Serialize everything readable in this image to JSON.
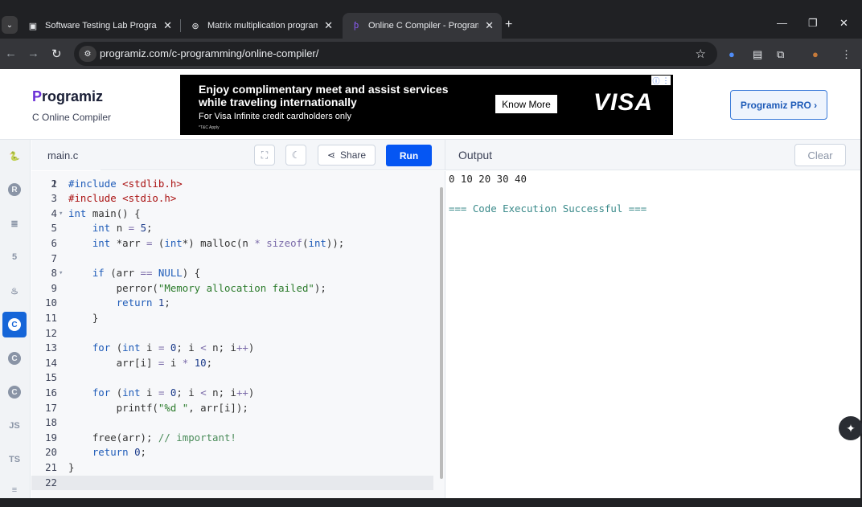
{
  "browser": {
    "tabs": [
      {
        "title": "Software Testing Lab Programs",
        "icon": "page-icon"
      },
      {
        "title": "Matrix multiplication program",
        "icon": "chatgpt-icon"
      },
      {
        "title": "Online C Compiler - Programiz",
        "icon": "programiz-icon",
        "active": true
      }
    ],
    "url": "programiz.com/c-programming/online-compiler/",
    "new_tab_glyph": "+",
    "close_glyph": "✕"
  },
  "site": {
    "logo_first": "P",
    "logo_rest": "rogramiz",
    "logo_sub": "C Online Compiler",
    "pro_button": "Programiz PRO ›"
  },
  "ad": {
    "line1": "Enjoy complimentary meet and assist services",
    "line2": "while traveling internationally",
    "line3": "For Visa Infinite credit cardholders only",
    "line4": "*T&C Apply",
    "cta": "Know More",
    "brand": "VISA"
  },
  "sidebar": {
    "items": [
      {
        "name": "python",
        "label": "🐍"
      },
      {
        "name": "r",
        "label": "R"
      },
      {
        "name": "sql",
        "label": "≣"
      },
      {
        "name": "html",
        "label": "5"
      },
      {
        "name": "java",
        "label": "♨"
      },
      {
        "name": "c",
        "label": "C",
        "active": true
      },
      {
        "name": "cpp",
        "label": "C"
      },
      {
        "name": "csharp",
        "label": "C"
      },
      {
        "name": "js",
        "label": "JS"
      },
      {
        "name": "ts",
        "label": "TS"
      },
      {
        "name": "more",
        "label": "≡"
      }
    ]
  },
  "editor": {
    "filename": "main.c",
    "share_label": "Share",
    "run_label": "Run",
    "partial_top": "#include <stdio.h>",
    "lines": [
      {
        "n": "2",
        "html": "<span class='kw'>#include</span> <span class='hdr'>&lt;stdlib.h&gt;</span>"
      },
      {
        "n": "3",
        "html": ""
      },
      {
        "n": "4",
        "fold": true,
        "html": "<span class='kw'>int</span> main() {"
      },
      {
        "n": "5",
        "html": "    <span class='kw'>int</span> n <span class='op'>=</span> <span class='num'>5</span>;"
      },
      {
        "n": "6",
        "html": "    <span class='kw'>int</span> *arr <span class='op'>=</span> (<span class='kw'>int</span>*) malloc(n <span class='op'>*</span> <span class='op'>sizeof</span>(<span class='kw'>int</span>));"
      },
      {
        "n": "7",
        "html": ""
      },
      {
        "n": "8",
        "fold": true,
        "html": "    <span class='kw'>if</span> (arr <span class='op'>==</span> <span class='kw'>NULL</span>) {"
      },
      {
        "n": "9",
        "html": "        perror(<span class='str'>\"Memory allocation failed\"</span>);"
      },
      {
        "n": "10",
        "html": "        <span class='kw'>return</span> <span class='num'>1</span>;"
      },
      {
        "n": "11",
        "html": "    }"
      },
      {
        "n": "12",
        "html": ""
      },
      {
        "n": "13",
        "html": "    <span class='kw'>for</span> (<span class='kw'>int</span> i <span class='op'>=</span> <span class='num'>0</span>; i <span class='op'>&lt;</span> n; i<span class='op'>++</span>)"
      },
      {
        "n": "14",
        "html": "        arr[i] <span class='op'>=</span> i <span class='op'>*</span> <span class='num'>10</span>;"
      },
      {
        "n": "15",
        "html": ""
      },
      {
        "n": "16",
        "html": "    <span class='kw'>for</span> (<span class='kw'>int</span> i <span class='op'>=</span> <span class='num'>0</span>; i <span class='op'>&lt;</span> n; i<span class='op'>++</span>)"
      },
      {
        "n": "17",
        "html": "        printf(<span class='str'>\"%d \"</span>, arr[i]);"
      },
      {
        "n": "18",
        "html": ""
      },
      {
        "n": "19",
        "html": "    free(arr); <span class='cmt'>// important!</span>"
      },
      {
        "n": "20",
        "html": "    <span class='kw'>return</span> <span class='num'>0</span>;"
      },
      {
        "n": "21",
        "html": "}"
      },
      {
        "n": "22",
        "html": "",
        "current": true
      }
    ]
  },
  "output": {
    "title": "Output",
    "clear_label": "Clear",
    "line1": "0 10 20 30 40",
    "line2": "=== Code Execution Successful ==="
  }
}
